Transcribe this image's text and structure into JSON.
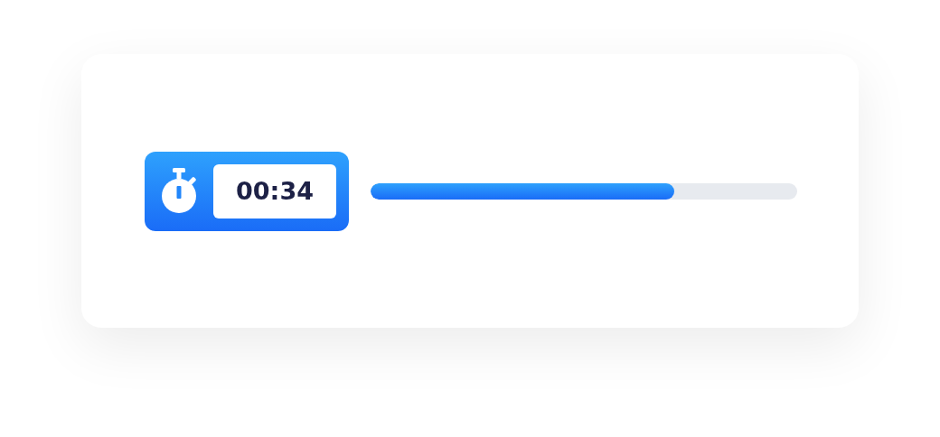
{
  "timer": {
    "time": "00:34"
  },
  "progress": {
    "level": 0.712
  }
}
